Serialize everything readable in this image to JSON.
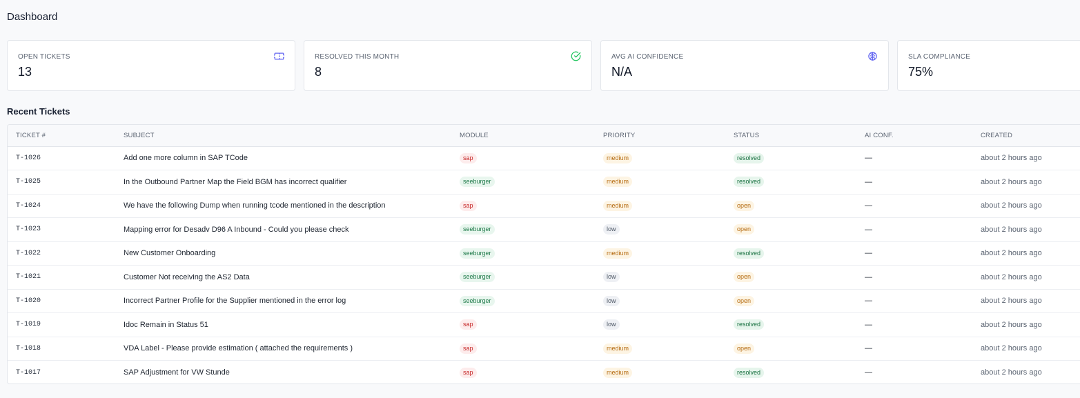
{
  "page": {
    "title": "Dashboard"
  },
  "stats": [
    {
      "label": "OPEN TICKETS",
      "value": "13",
      "icon": "ticket-icon",
      "icon_color": "#6366f1"
    },
    {
      "label": "RESOLVED THIS MONTH",
      "value": "8",
      "icon": "check-circle-icon",
      "icon_color": "#22c55e"
    },
    {
      "label": "AVG AI CONFIDENCE",
      "value": "N/A",
      "icon": "brain-icon",
      "icon_color": "#6366f1"
    },
    {
      "label": "SLA COMPLIANCE",
      "value": "75%",
      "icon": "",
      "icon_color": ""
    }
  ],
  "recent": {
    "title": "Recent Tickets",
    "columns": [
      "TICKET #",
      "SUBJECT",
      "MODULE",
      "PRIORITY",
      "STATUS",
      "AI CONF.",
      "CREATED"
    ],
    "rows": [
      {
        "id": "T-1026",
        "subject": "Add one more column in SAP TCode",
        "module": "sap",
        "priority": "medium",
        "status": "resolved",
        "ai": "—",
        "created": "about 2 hours ago"
      },
      {
        "id": "T-1025",
        "subject": "In the Outbound Partner Map the Field BGM has incorrect qualifier",
        "module": "seeburger",
        "priority": "medium",
        "status": "resolved",
        "ai": "—",
        "created": "about 2 hours ago"
      },
      {
        "id": "T-1024",
        "subject": "We have the following Dump when running tcode mentioned in the description",
        "module": "sap",
        "priority": "medium",
        "status": "open",
        "ai": "—",
        "created": "about 2 hours ago"
      },
      {
        "id": "T-1023",
        "subject": "Mapping error for Desadv D96 A Inbound - Could you please check",
        "module": "seeburger",
        "priority": "low",
        "status": "open",
        "ai": "—",
        "created": "about 2 hours ago"
      },
      {
        "id": "T-1022",
        "subject": "New Customer Onboarding",
        "module": "seeburger",
        "priority": "medium",
        "status": "resolved",
        "ai": "—",
        "created": "about 2 hours ago"
      },
      {
        "id": "T-1021",
        "subject": "Customer Not receiving the AS2 Data",
        "module": "seeburger",
        "priority": "low",
        "status": "open",
        "ai": "—",
        "created": "about 2 hours ago"
      },
      {
        "id": "T-1020",
        "subject": "Incorrect Partner Profile for the Supplier mentioned in the error log",
        "module": "seeburger",
        "priority": "low",
        "status": "open",
        "ai": "—",
        "created": "about 2 hours ago"
      },
      {
        "id": "T-1019",
        "subject": "Idoc Remain in Status 51",
        "module": "sap",
        "priority": "low",
        "status": "resolved",
        "ai": "—",
        "created": "about 2 hours ago"
      },
      {
        "id": "T-1018",
        "subject": "VDA Label - Please provide estimation ( attached the requirements )",
        "module": "sap",
        "priority": "medium",
        "status": "open",
        "ai": "—",
        "created": "about 2 hours ago"
      },
      {
        "id": "T-1017",
        "subject": "SAP Adjustment for VW Stunde",
        "module": "sap",
        "priority": "medium",
        "status": "resolved",
        "ai": "—",
        "created": "about 2 hours ago"
      }
    ]
  }
}
